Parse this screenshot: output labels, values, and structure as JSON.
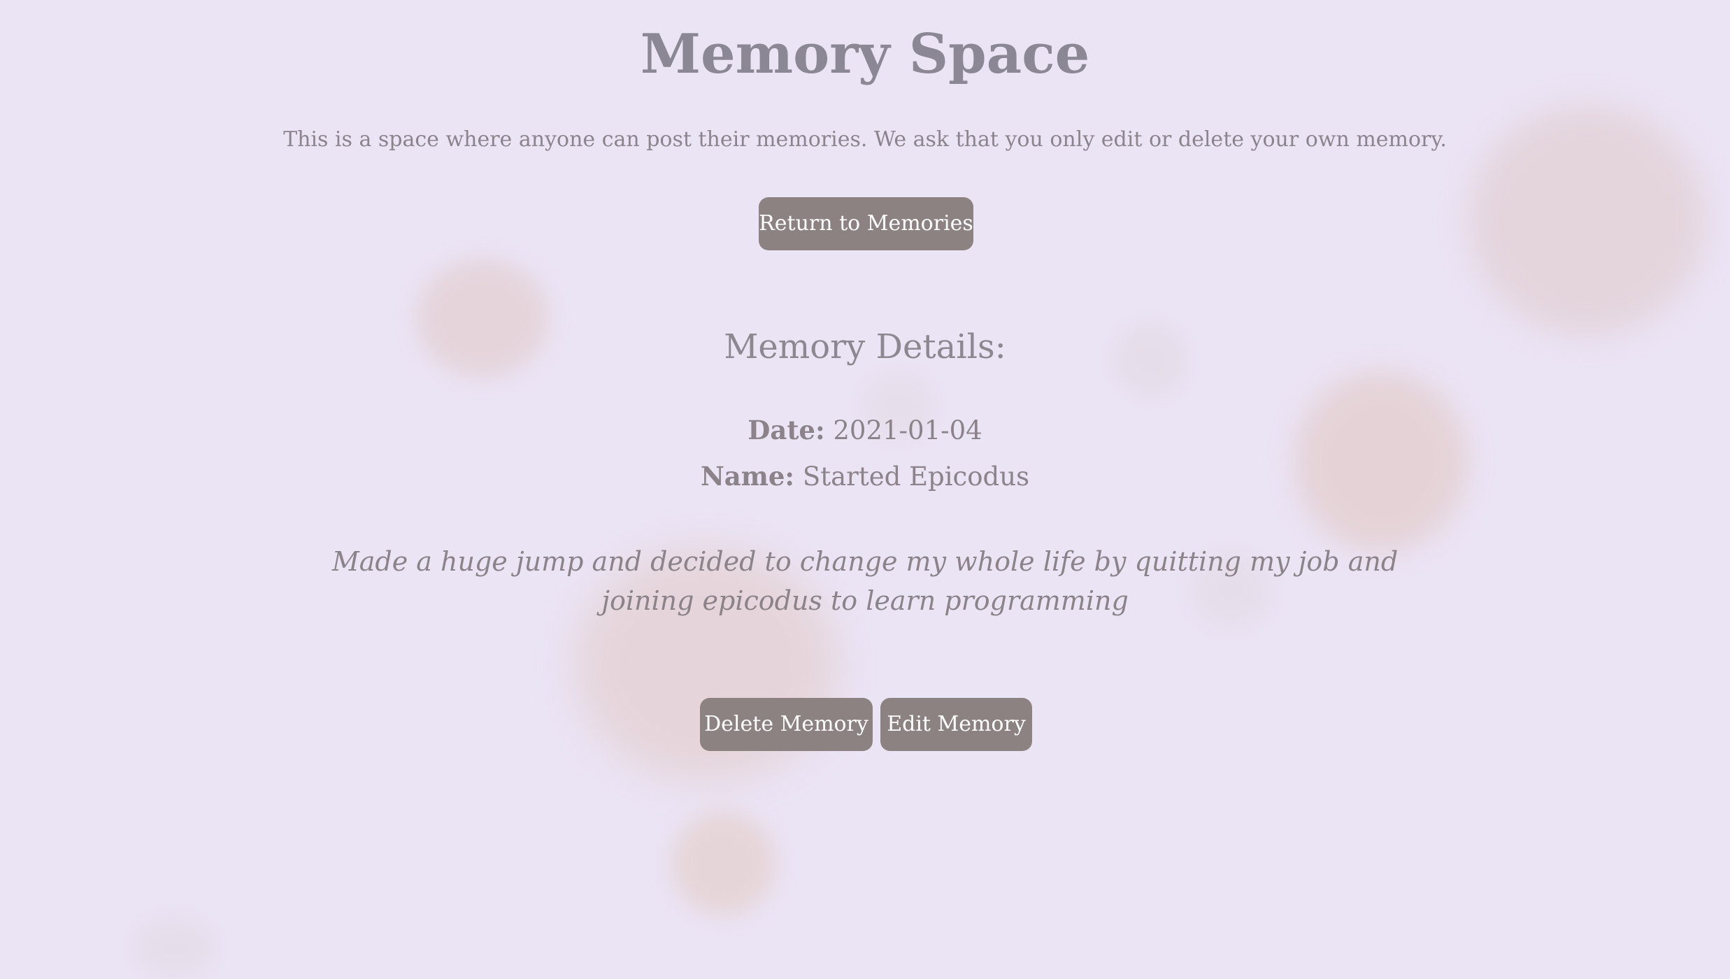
{
  "header": {
    "title": "Memory Space",
    "intro": "This is a space where anyone can post their memories. We ask that you only edit or delete your own memory."
  },
  "nav": {
    "return_label": "Return to Memories"
  },
  "details": {
    "heading": "Memory Details:",
    "date_label": "Date:",
    "date_value": "2021-01-04",
    "name_label": "Name:",
    "name_value": "Started Epicodus",
    "description": "Made a huge jump and decided to change my whole life by quitting my job and joining epicodus to learn programming"
  },
  "actions": {
    "delete_label": "Delete Memory",
    "edit_label": "Edit Memory"
  },
  "colors": {
    "background": "#ebe4f5",
    "button": "#8d8282",
    "text": "#8b8289"
  }
}
